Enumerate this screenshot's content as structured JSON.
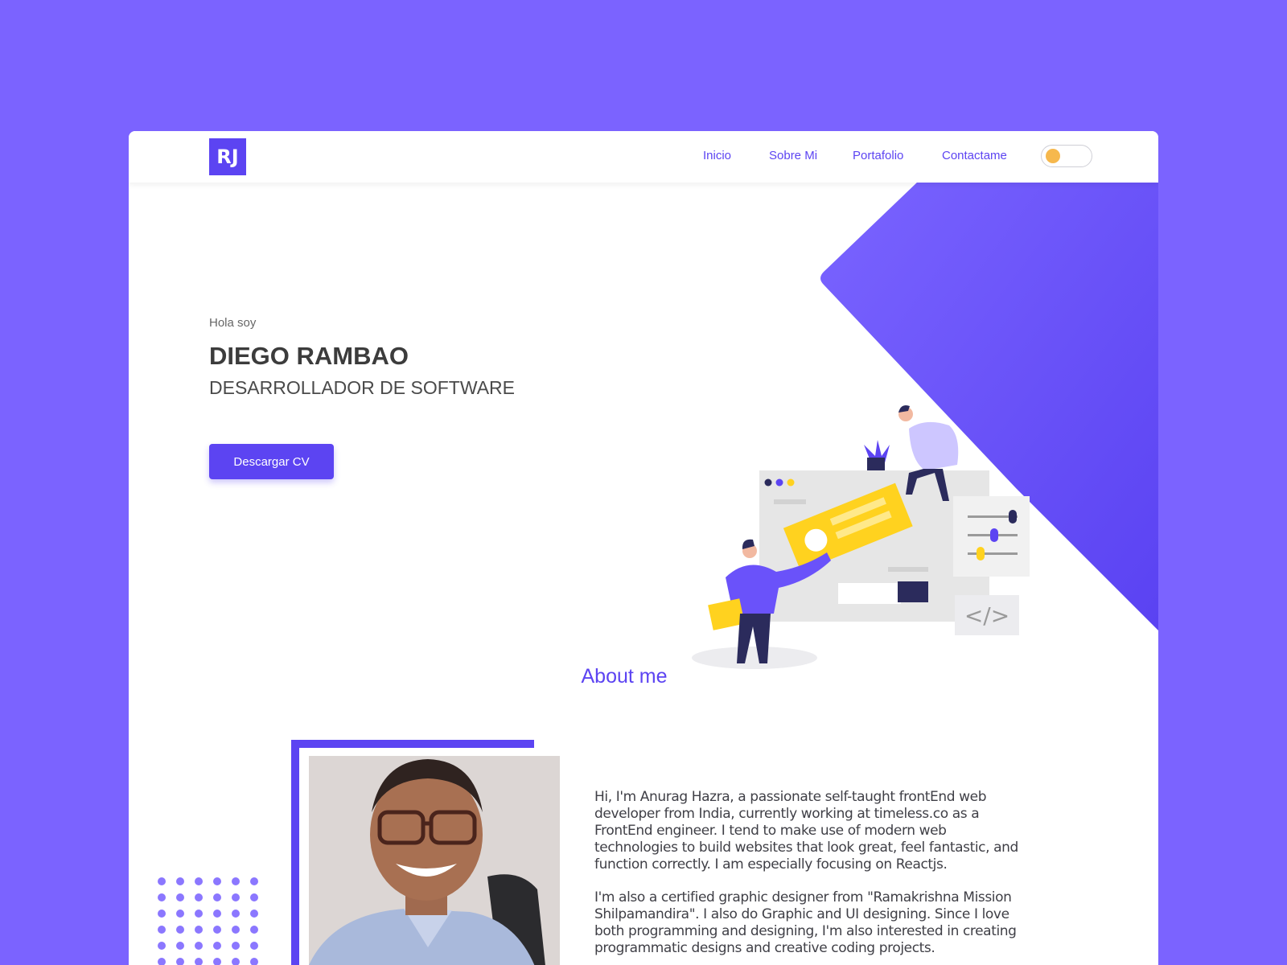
{
  "navbar": {
    "logo": "RJ",
    "links": [
      "Inicio",
      "Sobre Mi",
      "Portafolio",
      "Contactame"
    ],
    "theme_toggle": {
      "state": "off",
      "knob_color": "#f6b84d"
    }
  },
  "hero": {
    "greeting": "Hola soy",
    "name": "DIEGO RAMBAO",
    "role": "DESARROLLADOR DE SOFTWARE",
    "cta_label": "Descargar CV",
    "illustration": "developers-collaboration-illustration"
  },
  "about": {
    "title": "About me",
    "paragraphs": [
      "Hi, I'm Anurag Hazra, a passionate self-taught frontEnd web developer from India, currently working at timeless.co as a FrontEnd engineer. I tend to make use of modern web technologies to build websites that look great, feel fantastic, and function correctly. I am especially focusing on Reactjs.",
      "I'm also a certified graphic designer from \"Ramakrishna Mission Shilpamandira\". I also do Graphic and UI designing. Since I love both programming and designing, I'm also interested in creating programmatic designs and creative coding projects."
    ]
  },
  "colors": {
    "page_background": "#7b63ff",
    "accent": "#5c44f2",
    "highlight_yellow": "#ffd21f"
  }
}
